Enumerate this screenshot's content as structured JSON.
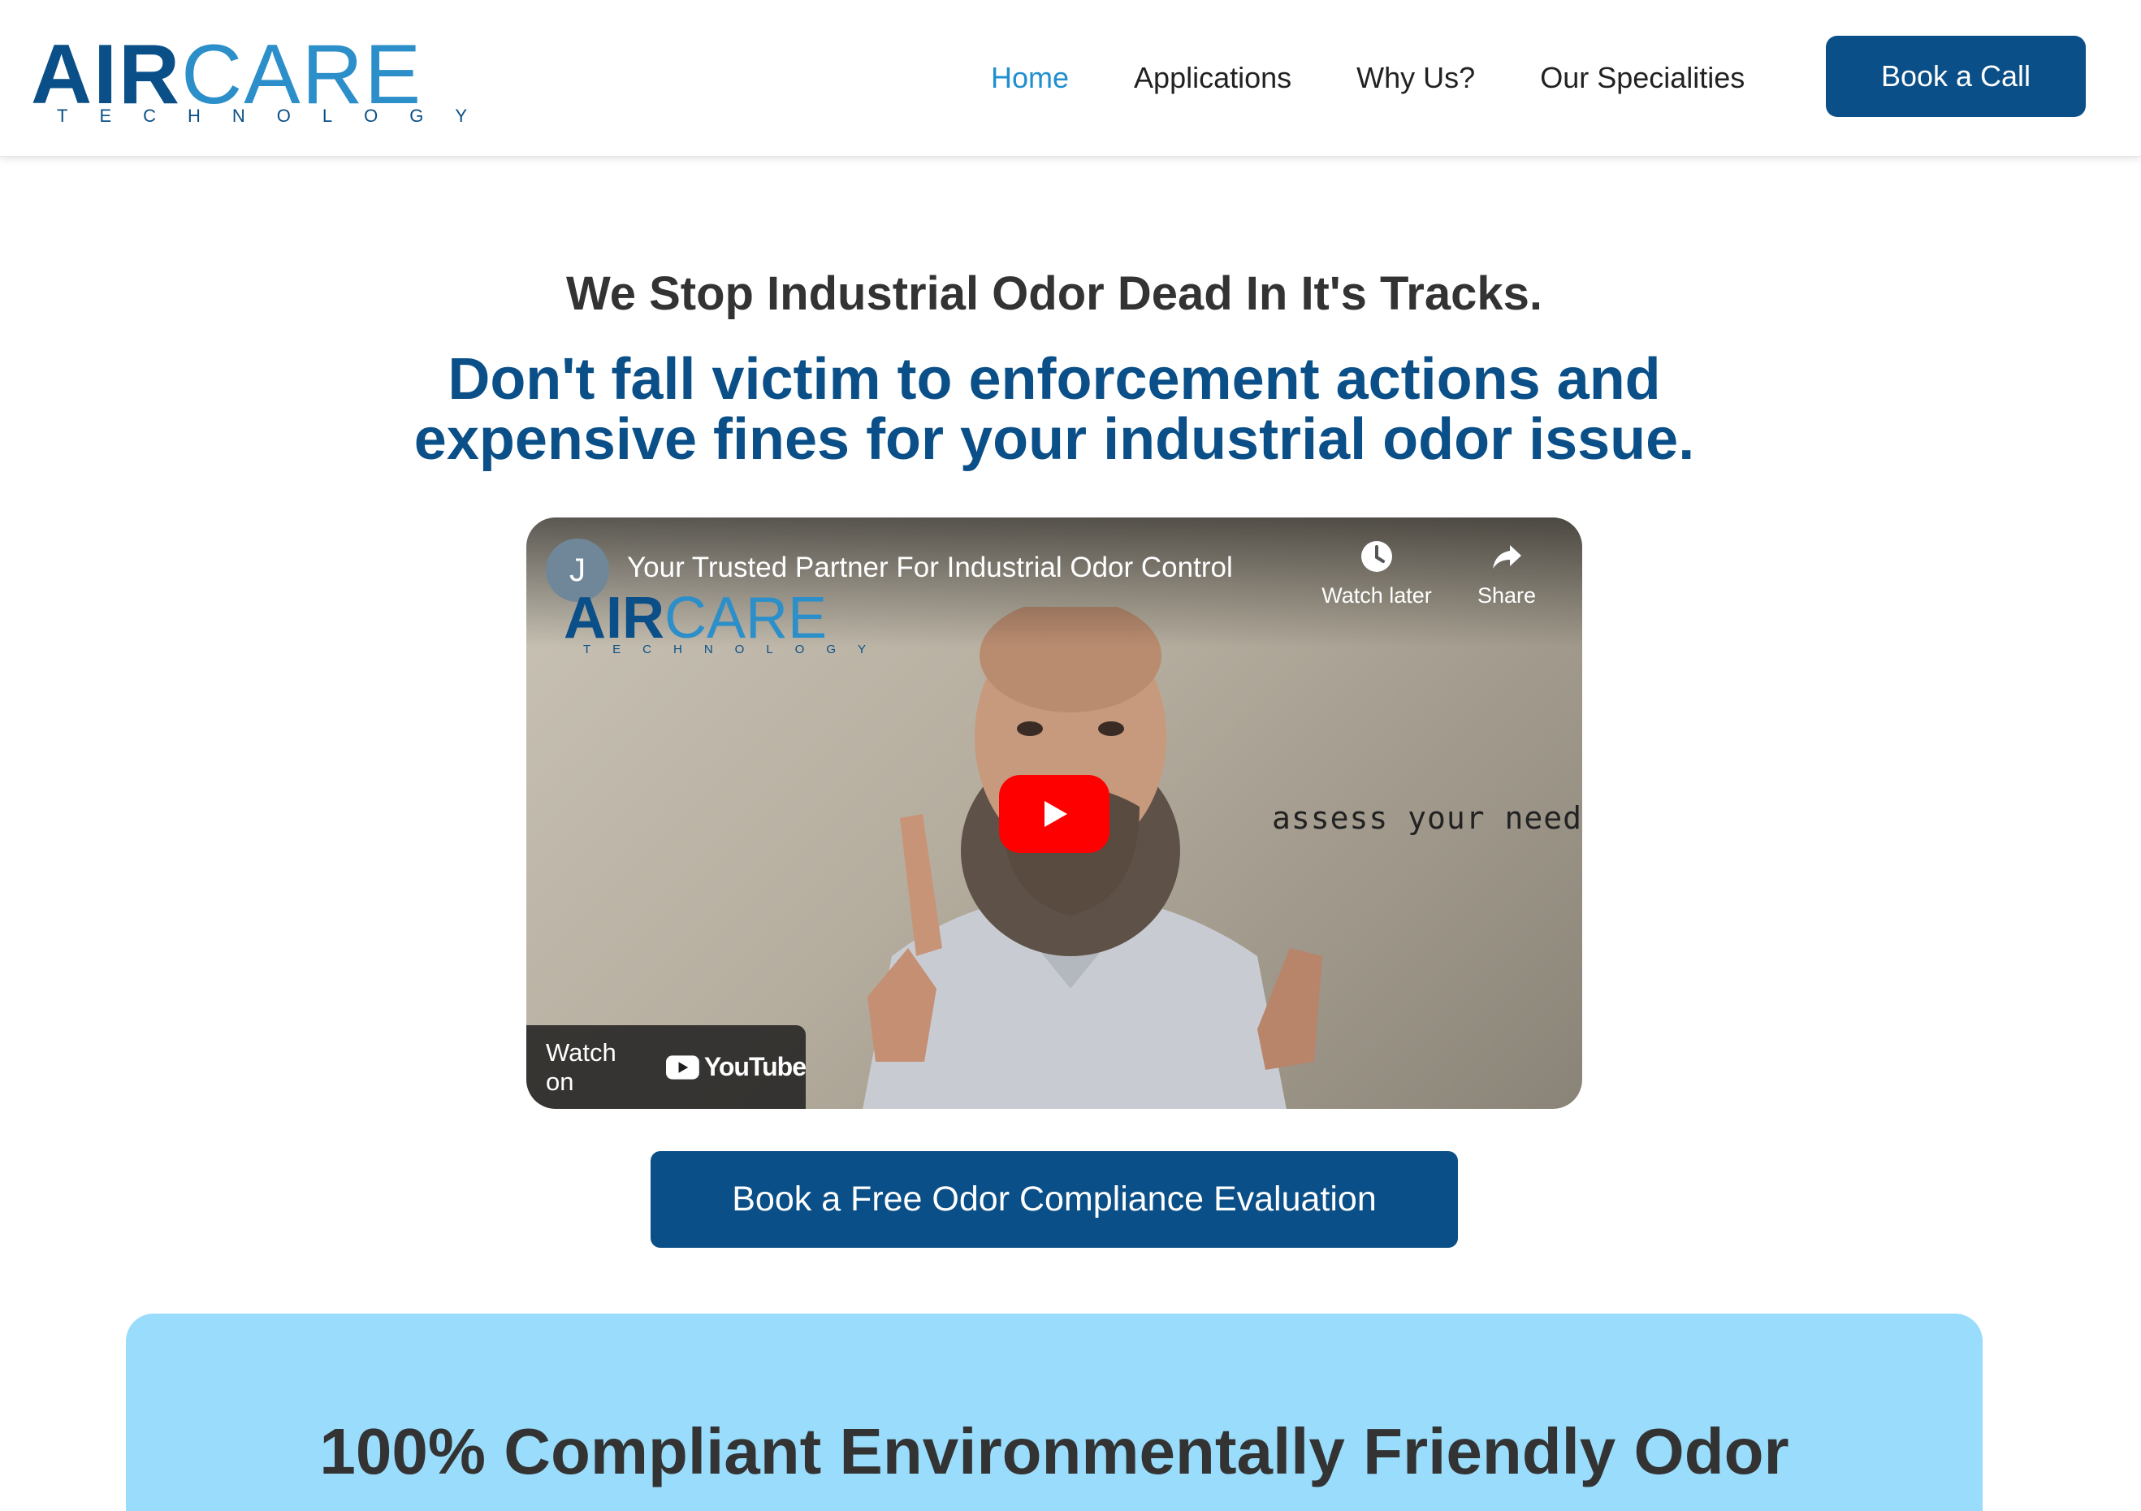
{
  "header": {
    "logo": {
      "primary_bold": "AIR",
      "primary_light": "CARE",
      "tagline": "TECHNOLOGY"
    },
    "nav": [
      {
        "label": "Home",
        "active": true
      },
      {
        "label": "Applications",
        "active": false
      },
      {
        "label": "Why Us?",
        "active": false
      },
      {
        "label": "Our Specialities",
        "active": false
      }
    ],
    "cta_label": "Book a Call"
  },
  "hero": {
    "headline": "We Stop Industrial Odor Dead In It's Tracks.",
    "subheadline": "Don't fall victim to enforcement actions and expensive fines for your industrial odor issue."
  },
  "video": {
    "channel_initial": "J",
    "title": "Your Trusted Partner For Industrial Odor Control",
    "watermark_logo": {
      "primary_bold": "AIR",
      "primary_light": "CARE",
      "tagline": "TECHNOLOGY"
    },
    "watch_later_label": "Watch later",
    "share_label": "Share",
    "overlay_caption": "assess your needs",
    "watch_on_label": "Watch on",
    "platform_label": "YouTube"
  },
  "cta": {
    "label": "Book a Free Odor Compliance Evaluation"
  },
  "band": {
    "title": "100% Compliant Environmentally Friendly Odor"
  },
  "colors": {
    "brand_dark": "#0a4f87",
    "brand_light": "#2c8fc9",
    "nav_active": "#1f8fcf",
    "band_background": "#99dcfb",
    "youtube_red": "#ff0000"
  },
  "icons": [
    "clock-icon",
    "share-arrow-icon",
    "play-icon",
    "youtube-logo-icon"
  ]
}
